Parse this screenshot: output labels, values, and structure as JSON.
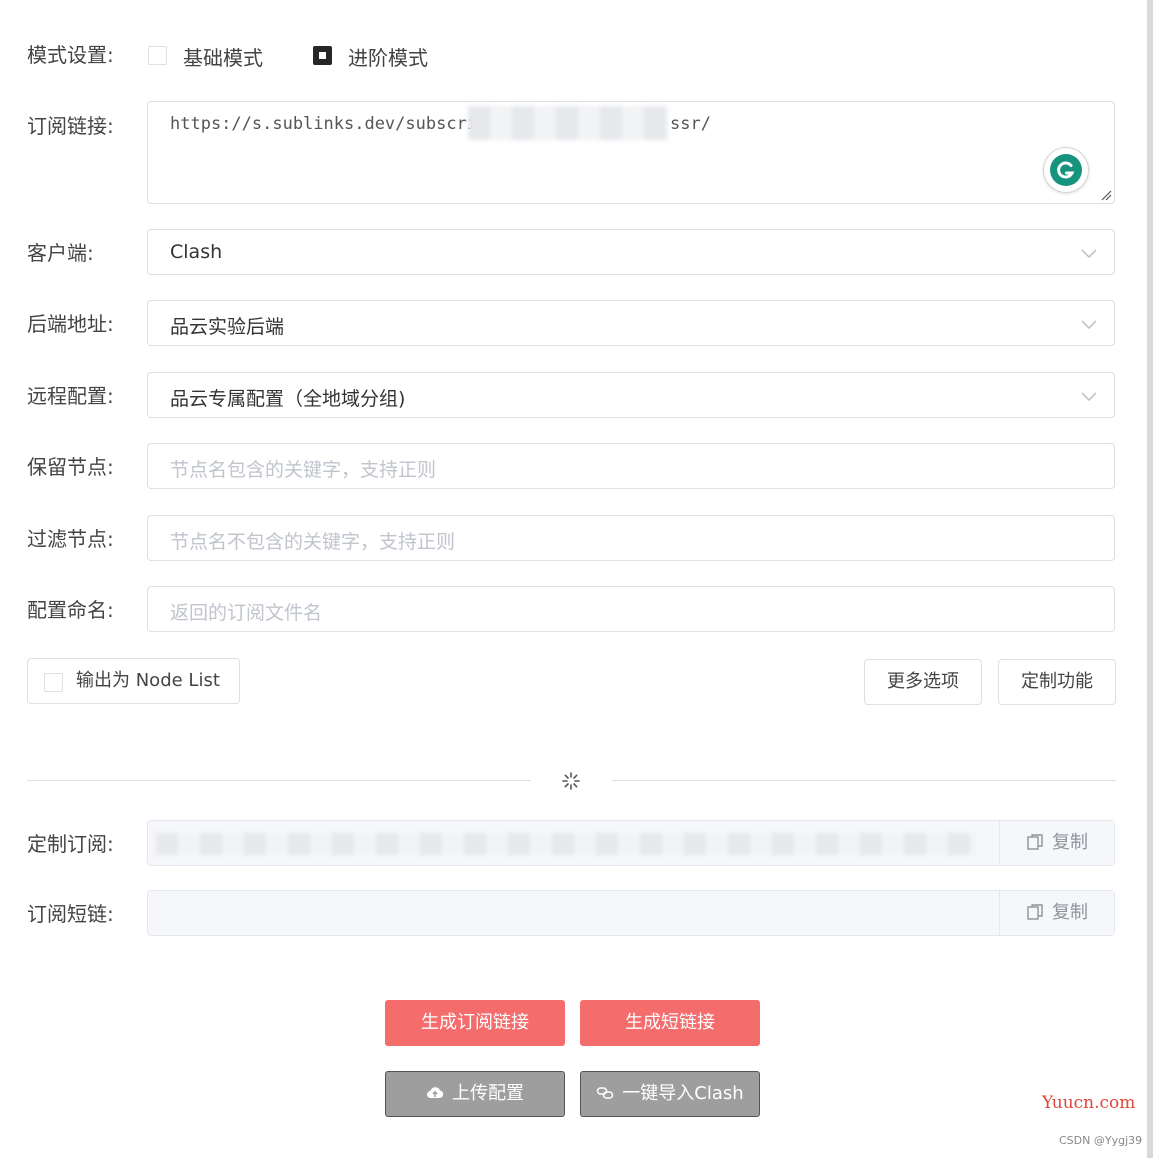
{
  "mode": {
    "label": "模式设置:",
    "basic": "基础模式",
    "advanced": "进阶模式",
    "selected": "advanced"
  },
  "subscription": {
    "label": "订阅链接:",
    "value_start": "https://s.sublinks.dev/subscril",
    "value_end": "ssr/"
  },
  "client": {
    "label": "客户端:",
    "value": "Clash"
  },
  "backend": {
    "label": "后端地址:",
    "value": "品云实验后端"
  },
  "remote": {
    "label": "远程配置:",
    "value": "品云专属配置（全地域分组)"
  },
  "keep_nodes": {
    "label": "保留节点:",
    "placeholder": "节点名包含的关键字，支持正则"
  },
  "filter_nodes": {
    "label": "过滤节点:",
    "placeholder": "节点名不包含的关键字，支持正则"
  },
  "config_name": {
    "label": "配置命名:",
    "placeholder": "返回的订阅文件名"
  },
  "node_list": {
    "label": "输出为 Node List",
    "checked": false
  },
  "more_options": "更多选项",
  "custom_features": "定制功能",
  "custom_sub": {
    "label": "定制订阅:",
    "copy": "复制"
  },
  "short_link": {
    "label": "订阅短链:",
    "copy": "复制"
  },
  "actions": {
    "gen_sub": "生成订阅链接",
    "gen_short": "生成短链接",
    "upload": "上传配置",
    "import_clash": "一键导入Clash"
  },
  "watermark": {
    "site": "Yuucn.com",
    "author": "CSDN @Yygj39"
  },
  "colors": {
    "primary": "#f56c6c",
    "gray_button": "#9e9e9e",
    "grammarly": "#15c39a"
  }
}
